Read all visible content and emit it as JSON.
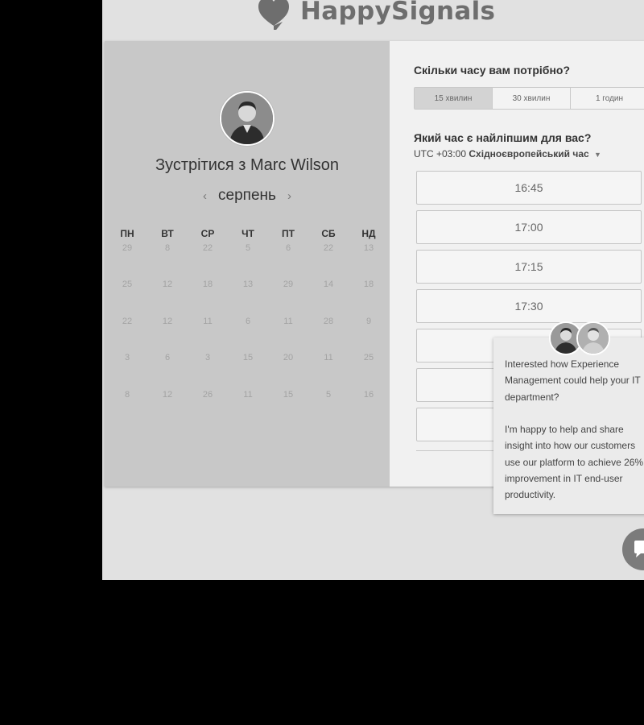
{
  "header": {
    "logo_text": "HappySignals",
    "logo_icon": "speech-heart-logo"
  },
  "calendar": {
    "title_prefix": "Зустрітися з",
    "host_name": "Marc Wilson",
    "month": "серпень",
    "weekdays": [
      "ПН",
      "ВТ",
      "СР",
      "ЧТ",
      "ПТ",
      "СБ",
      "НД"
    ],
    "weeks": [
      [
        "29",
        "8",
        "22",
        "5",
        "6",
        "22",
        "13"
      ],
      [
        "25",
        "12",
        "18",
        "13",
        "29",
        "14",
        "18"
      ],
      [
        "22",
        "12",
        "11",
        "6",
        "11",
        "28",
        "9"
      ],
      [
        "3",
        "6",
        "3",
        "15",
        "20",
        "11",
        "25"
      ],
      [
        "8",
        "12",
        "26",
        "11",
        "15",
        "5",
        "16"
      ]
    ]
  },
  "scheduler": {
    "duration_question": "Скільки часу вам потрібно?",
    "durations": [
      "15 хвилин",
      "30 хвилин",
      "1 годин"
    ],
    "selected_duration_index": 0,
    "time_question": "Який час є найліпшим для вас?",
    "timezone_offset": "UTC +03:00",
    "timezone_name": "Східноєвропейський час",
    "slots": [
      "16:45",
      "17:00",
      "17:15",
      "17:30",
      "",
      "",
      ""
    ]
  },
  "chat_popup": {
    "line1": "Interested how Experience",
    "line2": "Management could help your IT",
    "line3": "department?",
    "line4": "I'm happy to help and share",
    "line5": "insight into how our customers",
    "line6": "use our platform to achieve 26%",
    "line7": "improvement in IT end-user",
    "line8": "productivity."
  },
  "colors": {
    "overlay_dim": "#000000",
    "left_panel": "#c8c8c8",
    "right_panel": "#f1f1f1"
  }
}
